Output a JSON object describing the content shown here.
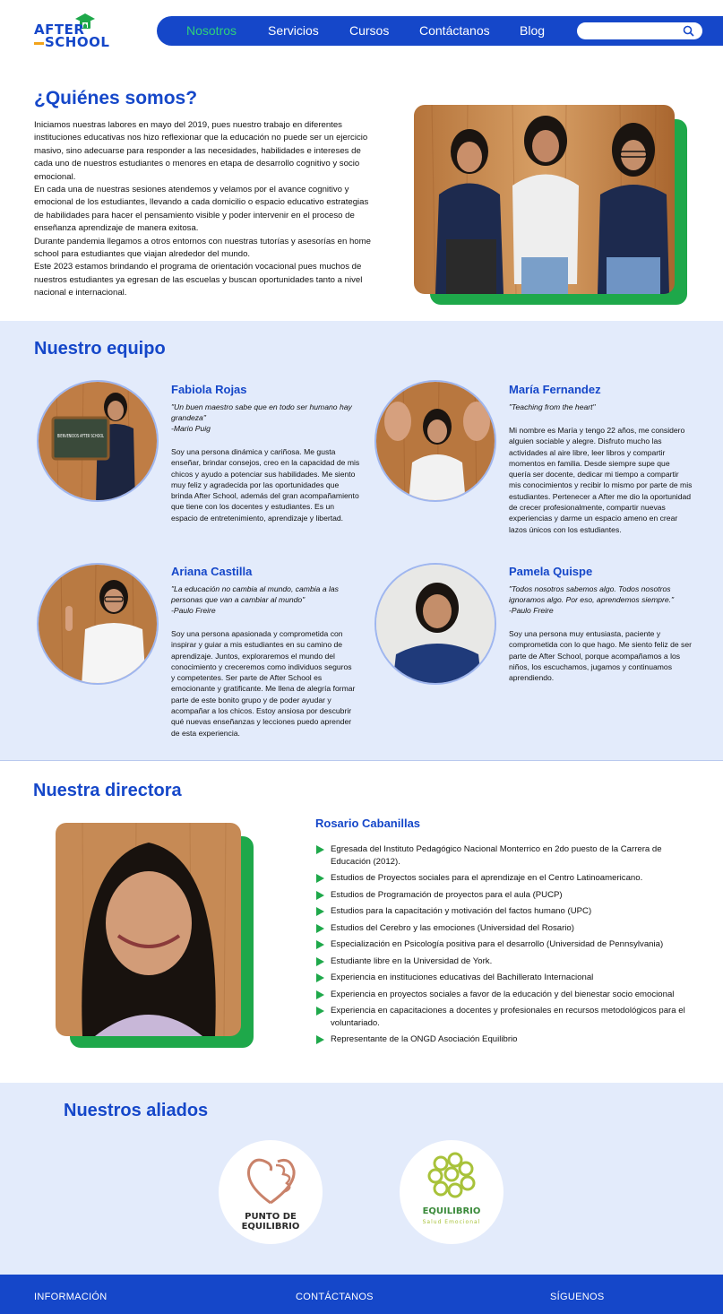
{
  "brand": {
    "logo_line1": "AFTER",
    "logo_line2": "SCHOOL"
  },
  "nav": {
    "items": [
      "Nosotros",
      "Servicios",
      "Cursos",
      "Contáctanos",
      "Blog"
    ],
    "active_index": 0,
    "search_placeholder": ""
  },
  "about": {
    "title": "¿Quiénes somos?",
    "paragraphs": [
      "Iniciamos nuestras labores en mayo del 2019, pues nuestro trabajo en diferentes instituciones educativas nos hizo reflexionar que la educación no puede ser un ejercicio masivo, sino adecuarse para responder a las necesidades, habilidades e intereses de cada uno de nuestros estudiantes o menores en etapa de desarrollo cognitivo y socio emocional.",
      "En cada una de nuestras sesiones atendemos y velamos por el avance cognitivo y emocional de los estudiantes, llevando a cada domicilio o espacio educativo estrategias de habilidades para hacer el pensamiento visible y poder intervenir en el proceso de enseñanza aprendizaje de manera exitosa.",
      "Durante pandemia llegamos a otros entornos con nuestras tutorías y asesorías en home school para estudiantes que viajan alrededor del mundo.",
      "Este 2023 estamos brindando el programa de orientación vocacional pues muchos de nuestros estudiantes ya egresan de las escuelas y buscan oportunidades tanto a nivel nacional e internacional."
    ]
  },
  "team": {
    "title": "Nuestro equipo",
    "members": [
      {
        "name": "Fabiola Rojas",
        "quote": "\"Un buen maestro sabe que en todo ser humano hay grandeza\"",
        "quote_author": "-Mario Puig",
        "bio": "Soy una persona dinámica y cariñosa. Me gusta enseñar, brindar consejos, creo en la capacidad de mis chicos y ayudo a potenciar sus habilidades. Me siento muy feliz y agradecida por las oportunidades que brinda After School, además del gran acompañamiento que tiene con los docentes y estudiantes. Es un espacio de entretenimiento, aprendizaje y libertad.",
        "sign_text": "BIENVENIDOS AFTER SCHOOL"
      },
      {
        "name": "María Fernandez",
        "quote": "\"Teaching from the heart\"",
        "quote_author": "",
        "bio": "Mi nombre es María y tengo 22 años, me considero alguien sociable y alegre. Disfruto mucho las actividades al aire libre, leer libros y compartir momentos en familia. Desde siempre supe que quería ser docente, dedicar mi tiempo a compartir mis conocimientos y recibir lo mismo por parte de mis estudiantes. Pertenecer a After me dio la oportunidad de crecer profesionalmente, compartir nuevas experiencias y darme un espacio ameno en crear lazos únicos con los estudiantes."
      },
      {
        "name": "Ariana Castilla",
        "quote": "\"La educación no cambia al mundo, cambia a las personas que van a cambiar al mundo\"",
        "quote_author": "-Paulo Freire",
        "bio": "Soy una persona apasionada y comprometida con inspirar y guiar a mis estudiantes en su camino de aprendizaje. Juntos, exploraremos el mundo del conocimiento y creceremos como individuos seguros y competentes. Ser parte de After School es emocionante y gratificante. Me llena de alegría formar parte de este bonito grupo y de poder ayudar y acompañar a los chicos. Estoy ansiosa por descubrir qué nuevas enseñanzas y lecciones puedo aprender de esta experiencia."
      },
      {
        "name": "Pamela Quispe",
        "quote": "\"Todos nosotros sabemos algo. Todos nosotros ignoramos algo. Por eso, aprendemos siempre.\"",
        "quote_author": "-Paulo Freire",
        "bio": "Soy una persona muy entusiasta, paciente y comprometida con lo que hago. Me siento feliz de ser parte de After School, porque acompañamos a los niños, los escuchamos, jugamos y continuamos aprendiendo."
      }
    ]
  },
  "director": {
    "title": "Nuestra directora",
    "name": "Rosario Cabanillas",
    "items": [
      "Egresada del Instituto Pedagógico Nacional Monterrico en 2do puesto de la Carrera de Educación (2012).",
      "Estudios de Proyectos sociales para el aprendizaje en el Centro Latinoamericano.",
      "Estudios de Programación de proyectos para el aula (PUCP)",
      "Estudios para la capacitación y motivación del factos humano (UPC)",
      "Estudios del Cerebro y las emociones (Universidad del Rosario)",
      "Especialización en Psicología positiva para el desarrollo (Universidad de Pennsylvania)",
      "Estudiante libre en la Universidad de York.",
      "Experiencia en instituciones educativas del Bachillerato Internacional",
      "Experiencia en proyectos sociales a favor de la educación y del bienestar socio emocional",
      "Experiencia en capacitaciones a docentes y profesionales en recursos metodológicos para el voluntariado.",
      "Representante de la ONGD Asociación Equilibrio"
    ]
  },
  "allies": {
    "title": "Nuestros aliados",
    "items": [
      {
        "line1": "PUNTO DE",
        "line2": "EQUILIBRIO"
      },
      {
        "line1": "EQUILIBRIO",
        "line2": "Salud Emocional"
      }
    ]
  },
  "footer": {
    "items": [
      "INFORMACIÓN",
      "CONTÁCTANOS",
      "SÍGUENOS"
    ]
  },
  "colors": {
    "brand_blue": "#1547c9",
    "accent_green": "#1ea84a",
    "nav_active": "#2fd07a",
    "section_bg": "#e3ebfb",
    "logo_orange": "#f2a31b"
  }
}
